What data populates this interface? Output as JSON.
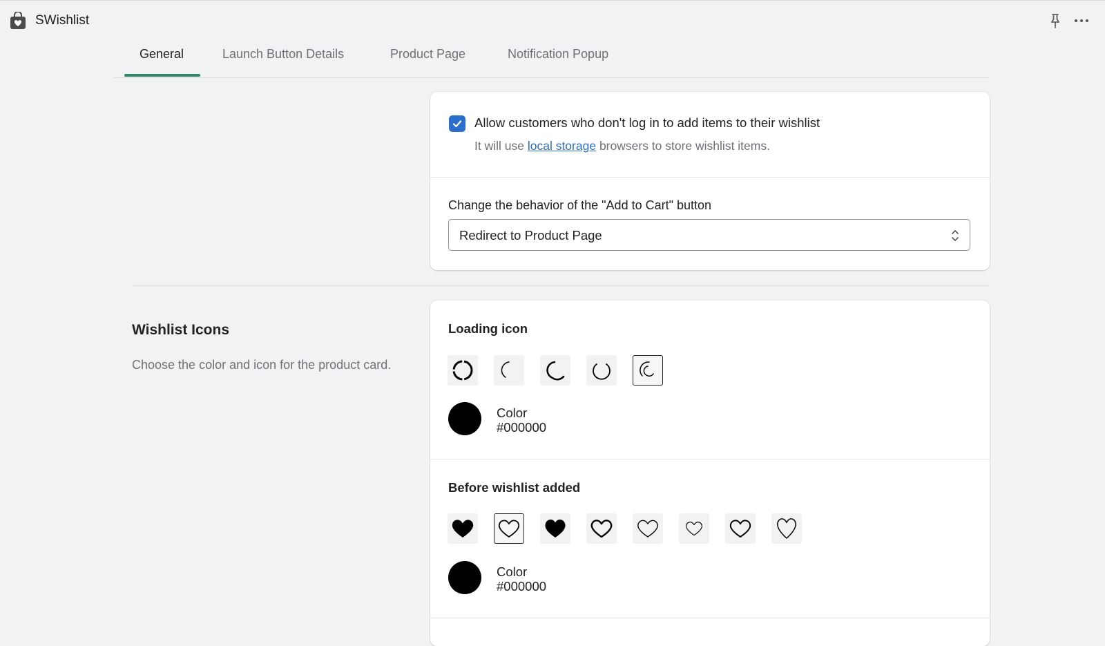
{
  "app": {
    "title": "SWishlist",
    "icon": "shopping-bag-heart-icon"
  },
  "topbar": {
    "pin_icon": "pin-icon",
    "more_icon": "more-horizontal-icon"
  },
  "tabs": [
    {
      "label": "General",
      "active": true
    },
    {
      "label": "Launch Button Details",
      "active": false
    },
    {
      "label": "Product Page",
      "active": false
    },
    {
      "label": "Notification Popup",
      "active": false
    }
  ],
  "settings": {
    "guest_checkbox": {
      "checked": true,
      "label": "Allow customers who don't log in to add items to their wishlist",
      "help_prefix": "It will use",
      "help_link": "local storage",
      "help_suffix": "browsers to store wishlist items."
    },
    "add_to_cart": {
      "label": "Change the behavior of the \"Add to Cart\" button",
      "value": "Redirect to Product Page"
    }
  },
  "wishlist_icons": {
    "title": "Wishlist Icons",
    "description": "Choose the color and icon for the product card.",
    "loading": {
      "heading": "Loading icon",
      "icons": [
        "spinner-ring-icon",
        "spinner-arc-thin-icon",
        "spinner-arc-thick-icon",
        "spinner-arc-open-icon",
        "spinner-arc-double-icon"
      ],
      "selected_index": 4,
      "color_label": "Color",
      "color": "#000000"
    },
    "before_added": {
      "heading": "Before wishlist added",
      "icons": [
        "heart-filled-icon",
        "heart-outline-icon",
        "heart-filled-bold-icon",
        "heart-outline-bold-icon",
        "heart-outline-thin-icon",
        "heart-outline-small-icon",
        "heart-outline-medium-icon",
        "heart-outline-tall-icon"
      ],
      "selected_index": 1,
      "color_label": "Color",
      "color": "#000000"
    }
  },
  "colors": {
    "accent": "#2e8a66",
    "checkbox": "#2c6ecb",
    "link": "#2c6ecb",
    "background": "#f1f2f4"
  }
}
